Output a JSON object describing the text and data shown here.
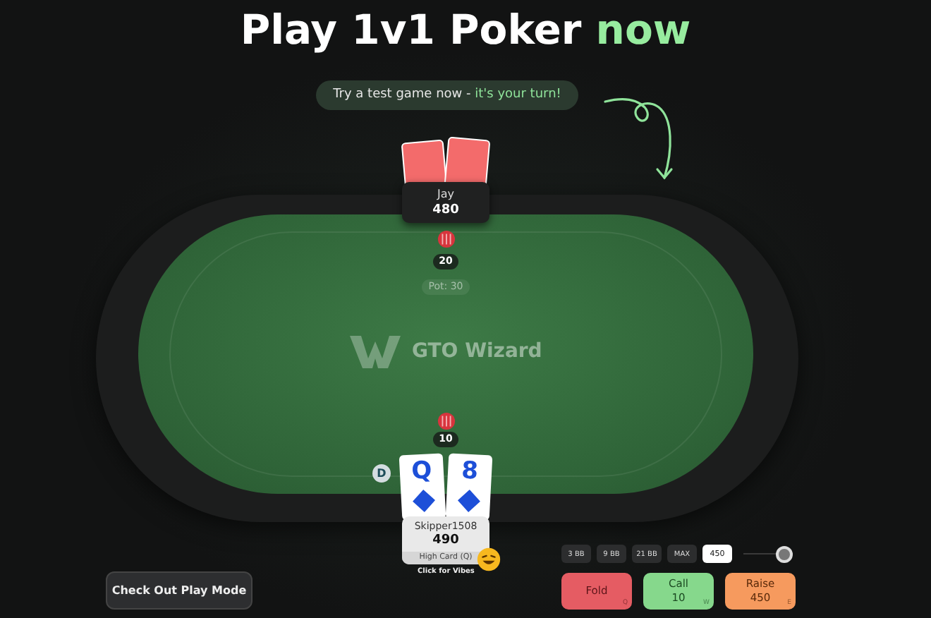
{
  "headline": "Play 1v1 Poker **now**",
  "prompt": "Try a test game now - **it's your turn!**",
  "watermark": "GTO Wizard",
  "opponent": {
    "name": "Jay",
    "stack": "480",
    "bet": "20"
  },
  "pot": "Pot: 30",
  "hero": {
    "name": "Skipper1508",
    "stack": "490",
    "bet": "10",
    "dealer": "D",
    "hand_label": "High Card (Q)",
    "vibes": "Click for Vibes",
    "cards": [
      {
        "rank": "Q"
      },
      {
        "rank": "8"
      }
    ]
  },
  "bet_presets": [
    {
      "label": "3 BB"
    },
    {
      "label": "9 BB"
    },
    {
      "label": "21 BB"
    },
    {
      "label": "MAX"
    }
  ],
  "bet_input": "450",
  "bet_slider": {
    "level": 1
  },
  "actions": [
    {
      "kind": "fold",
      "label": "Fold",
      "hotkey": "Q"
    },
    {
      "kind": "call",
      "label": "Call",
      "amount": "10",
      "hotkey": "W"
    },
    {
      "kind": "raise",
      "label": "Raise",
      "amount": "450",
      "hotkey": "E"
    }
  ],
  "cta": "Check Out Play Mode"
}
